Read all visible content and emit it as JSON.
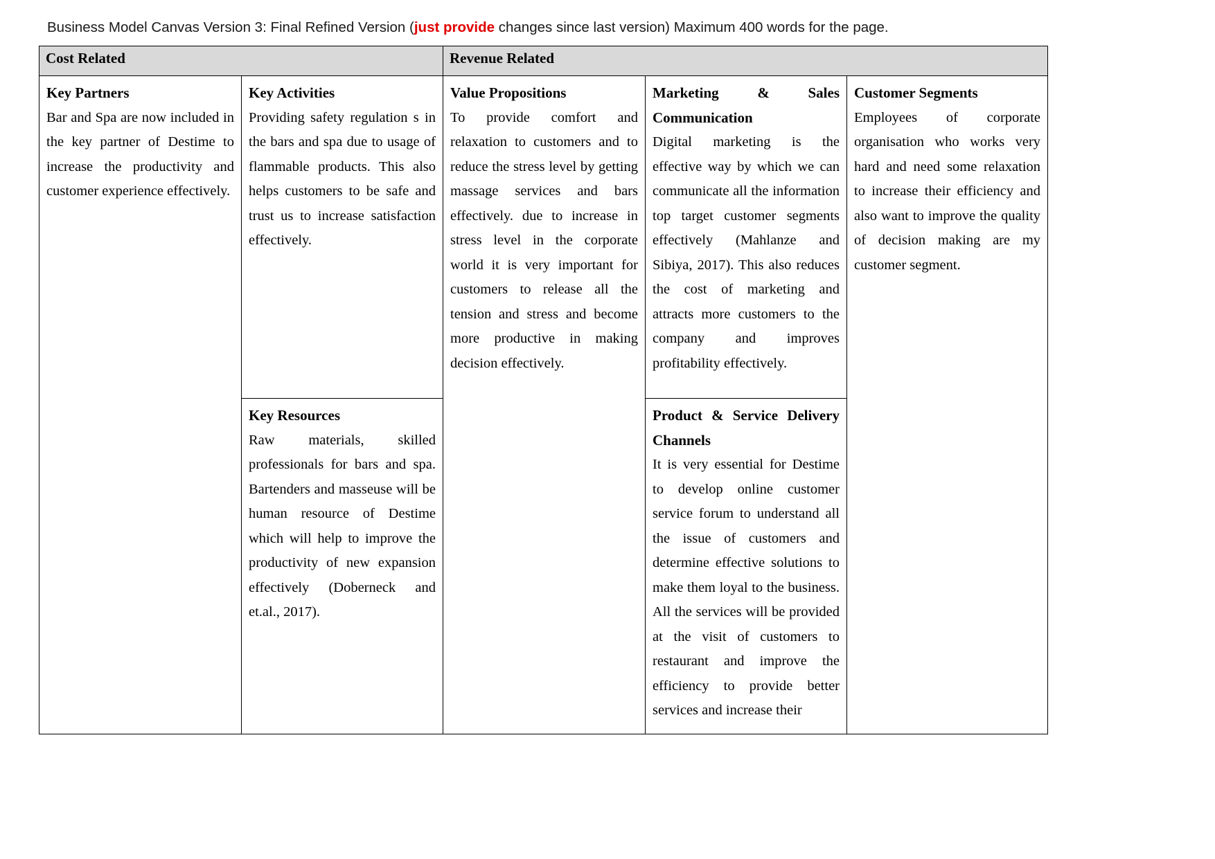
{
  "title": {
    "before": "Business Model Canvas Version 3: Final Refined Version (",
    "highlight": "just provide",
    "after": " changes since last version) Maximum 400 words for the page.",
    "highlight_color": "#e00000"
  },
  "table": {
    "header": {
      "cost_related": "Cost Related",
      "revenue_related": "Revenue Related"
    },
    "columns": {
      "key_partners": {
        "title": "Key Partners",
        "body": "Bar and Spa are now included in the key partner of Destime to increase the productivity and customer experience effectively."
      },
      "key_activities": {
        "title": "Key Activities",
        "body": "Providing safety regulation s in the bars and spa due to usage of flammable products.  This also helps customers to be safe and trust us to increase satisfaction effectively."
      },
      "key_resources": {
        "title": "Key Resources",
        "body": "Raw materials, skilled professionals for bars and spa. Bartenders and masseuse will be human resource of Destime which will help to improve the productivity of new expansion effectively (Doberneck and et.al., 2017)."
      },
      "value_propositions": {
        "title": "Value Propositions",
        "body": "To provide comfort and relaxation to customers and to reduce the stress level by getting massage services and bars effectively.  due to increase in stress level in the corporate world it is very important for customers to release all the tension and stress and become more productive  in making decision effectively."
      },
      "marketing_sales": {
        "title": "Marketing   &   Sales Communication",
        "body": "Digital marketing is the effective way by which we can communicate all the information top target customer segments effectively (Mahlanze and Sibiya, 2017). This also reduces the cost of marketing and attracts more customers to the company and improves profitability effectively."
      },
      "product_service": {
        "title": "Product  &  Service  Delivery Channels",
        "body": "It is very essential for Destime to develop online customer service forum to understand all the issue of customers and determine effective solutions to make them loyal to the business. All the services will be provided at the visit of customers to restaurant and improve the efficiency to provide better services and increase their"
      },
      "customer_segments": {
        "title": "Customer Segments",
        "body": "Employees of corporate organisation who works very hard and need some relaxation to increase their efficiency and also want to improve the quality of decision making are my customer segment."
      }
    }
  }
}
